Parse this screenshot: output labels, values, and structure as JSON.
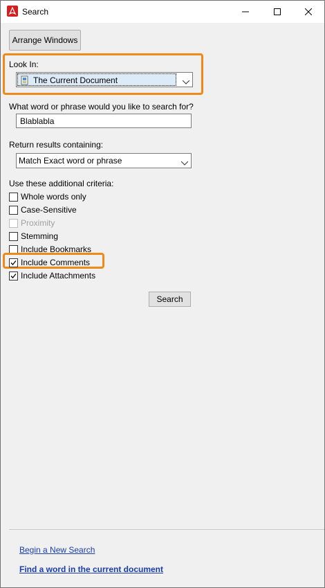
{
  "window": {
    "title": "Search",
    "controls": {
      "minimize": "minimize",
      "maximize": "maximize",
      "close": "close"
    }
  },
  "toolbar": {
    "arrange_windows_label": "Arrange Windows"
  },
  "look_in": {
    "label": "Look In:",
    "selected": "The Current Document",
    "icon": "document-icon"
  },
  "query": {
    "label": "What word or phrase would you like to search for?",
    "value": "Blablabla"
  },
  "return_results": {
    "label": "Return results containing:",
    "selected": "Match Exact word or phrase"
  },
  "criteria": {
    "label": "Use these additional criteria:",
    "items": [
      {
        "label": "Whole words only",
        "checked": false,
        "enabled": true
      },
      {
        "label": "Case-Sensitive",
        "checked": false,
        "enabled": true
      },
      {
        "label": "Proximity",
        "checked": false,
        "enabled": false
      },
      {
        "label": "Stemming",
        "checked": false,
        "enabled": true
      },
      {
        "label": "Include Bookmarks",
        "checked": false,
        "enabled": true
      },
      {
        "label": "Include Comments",
        "checked": true,
        "enabled": true
      },
      {
        "label": "Include Attachments",
        "checked": true,
        "enabled": true
      }
    ]
  },
  "search_button_label": "Search",
  "footer": {
    "new_search_link": "Begin a New Search",
    "find_word_link": "Find a word in the current document"
  },
  "colors": {
    "highlight": "#ef8a1a",
    "link": "#1a3dad",
    "app_icon": "#d21f1f"
  }
}
